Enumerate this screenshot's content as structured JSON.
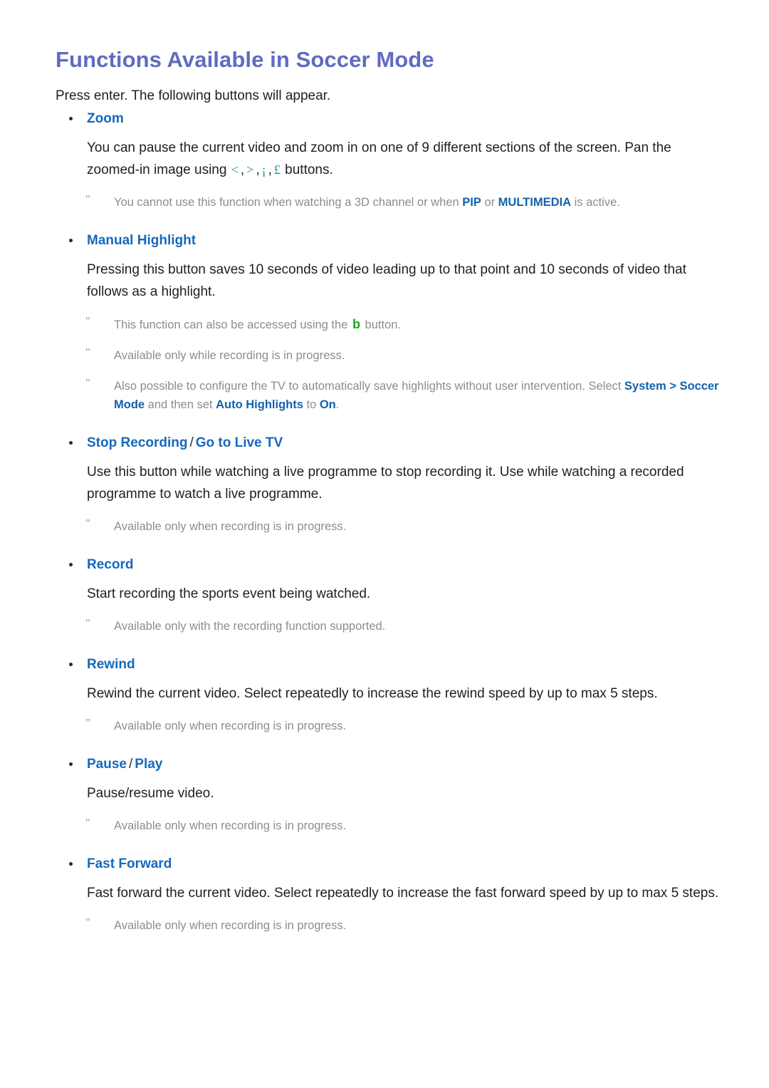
{
  "document": {
    "title": "Functions Available in Soccer Mode",
    "intro": "Press enter. The following buttons will appear."
  },
  "colors": {
    "title": "#5f6cc0",
    "heading_blue": "#1569bd",
    "note_gray": "#8d8d8d",
    "body_text": "#1f1f1f",
    "glyph_teal": "#1b8fa3",
    "key_green": "#18a818",
    "link_blue": "#1362ab"
  },
  "sections": [
    {
      "label": "Zoom",
      "body_part1": "You can pause the current video and zoom in on one of 9 different sections of the screen. Pan the zoomed-in image using ",
      "glyphs": [
        "<",
        ">",
        "¡",
        "£"
      ],
      "body_part2": " buttons.",
      "notes": [
        {
          "marker": "\"",
          "segments": [
            {
              "text": "You cannot use this function when watching a 3D channel or when ",
              "style": "plain"
            },
            {
              "text": "PIP",
              "style": "bold-blue"
            },
            {
              "text": " or ",
              "style": "plain"
            },
            {
              "text": "MULTIMEDIA",
              "style": "bold-blue"
            },
            {
              "text": " is active.",
              "style": "plain"
            }
          ]
        }
      ]
    },
    {
      "label": "Manual Highlight",
      "body": "Pressing this button saves 10 seconds of video leading up to that point and 10 seconds of video that follows as a highlight.",
      "notes": [
        {
          "marker": "\"",
          "segments": [
            {
              "text": "This function can also be accessed using the ",
              "style": "plain"
            },
            {
              "text": "b",
              "style": "key-green"
            },
            {
              "text": " button.",
              "style": "plain"
            }
          ]
        },
        {
          "marker": "\"",
          "segments": [
            {
              "text": "Available only while recording is in progress.",
              "style": "plain"
            }
          ]
        },
        {
          "marker": "\"",
          "segments": [
            {
              "text": "Also possible to configure the TV to automatically save highlights without user intervention. Select ",
              "style": "plain"
            },
            {
              "text": "System",
              "style": "bold-blue"
            },
            {
              "text": " > ",
              "style": "bold-blue"
            },
            {
              "text": "Soccer Mode",
              "style": "bold-blue"
            },
            {
              "text": " and then set ",
              "style": "plain"
            },
            {
              "text": "Auto Highlights",
              "style": "bold-blue"
            },
            {
              "text": " to ",
              "style": "plain"
            },
            {
              "text": "On",
              "style": "bold-blue"
            },
            {
              "text": ".",
              "style": "plain"
            }
          ]
        }
      ]
    },
    {
      "label": "Stop Recording",
      "label2": "Go to Live TV",
      "separator": "/",
      "body": "Use this button while watching a live programme to stop recording it. Use while watching a recorded programme to watch a live programme.",
      "notes": [
        {
          "marker": "\"",
          "segments": [
            {
              "text": "Available only when recording is in progress.",
              "style": "plain"
            }
          ]
        }
      ]
    },
    {
      "label": "Record",
      "body": "Start recording the sports event being watched.",
      "notes": [
        {
          "marker": "\"",
          "segments": [
            {
              "text": "Available only with the recording function supported.",
              "style": "plain"
            }
          ]
        }
      ]
    },
    {
      "label": "Rewind",
      "body": "Rewind the current video. Select repeatedly to increase the rewind speed by up to max 5 steps.",
      "notes": [
        {
          "marker": "\"",
          "segments": [
            {
              "text": "Available only when recording is in progress.",
              "style": "plain"
            }
          ]
        }
      ]
    },
    {
      "label": "Pause",
      "label2": "Play",
      "separator": "/",
      "body": "Pause/resume video.",
      "notes": [
        {
          "marker": "\"",
          "segments": [
            {
              "text": "Available only when recording is in progress.",
              "style": "plain"
            }
          ]
        }
      ]
    },
    {
      "label": "Fast Forward",
      "body": "Fast forward the current video. Select repeatedly to increase the fast forward speed by up to max 5 steps.",
      "notes": [
        {
          "marker": "\"",
          "segments": [
            {
              "text": "Available only when recording is in progress.",
              "style": "plain"
            }
          ]
        }
      ]
    }
  ]
}
